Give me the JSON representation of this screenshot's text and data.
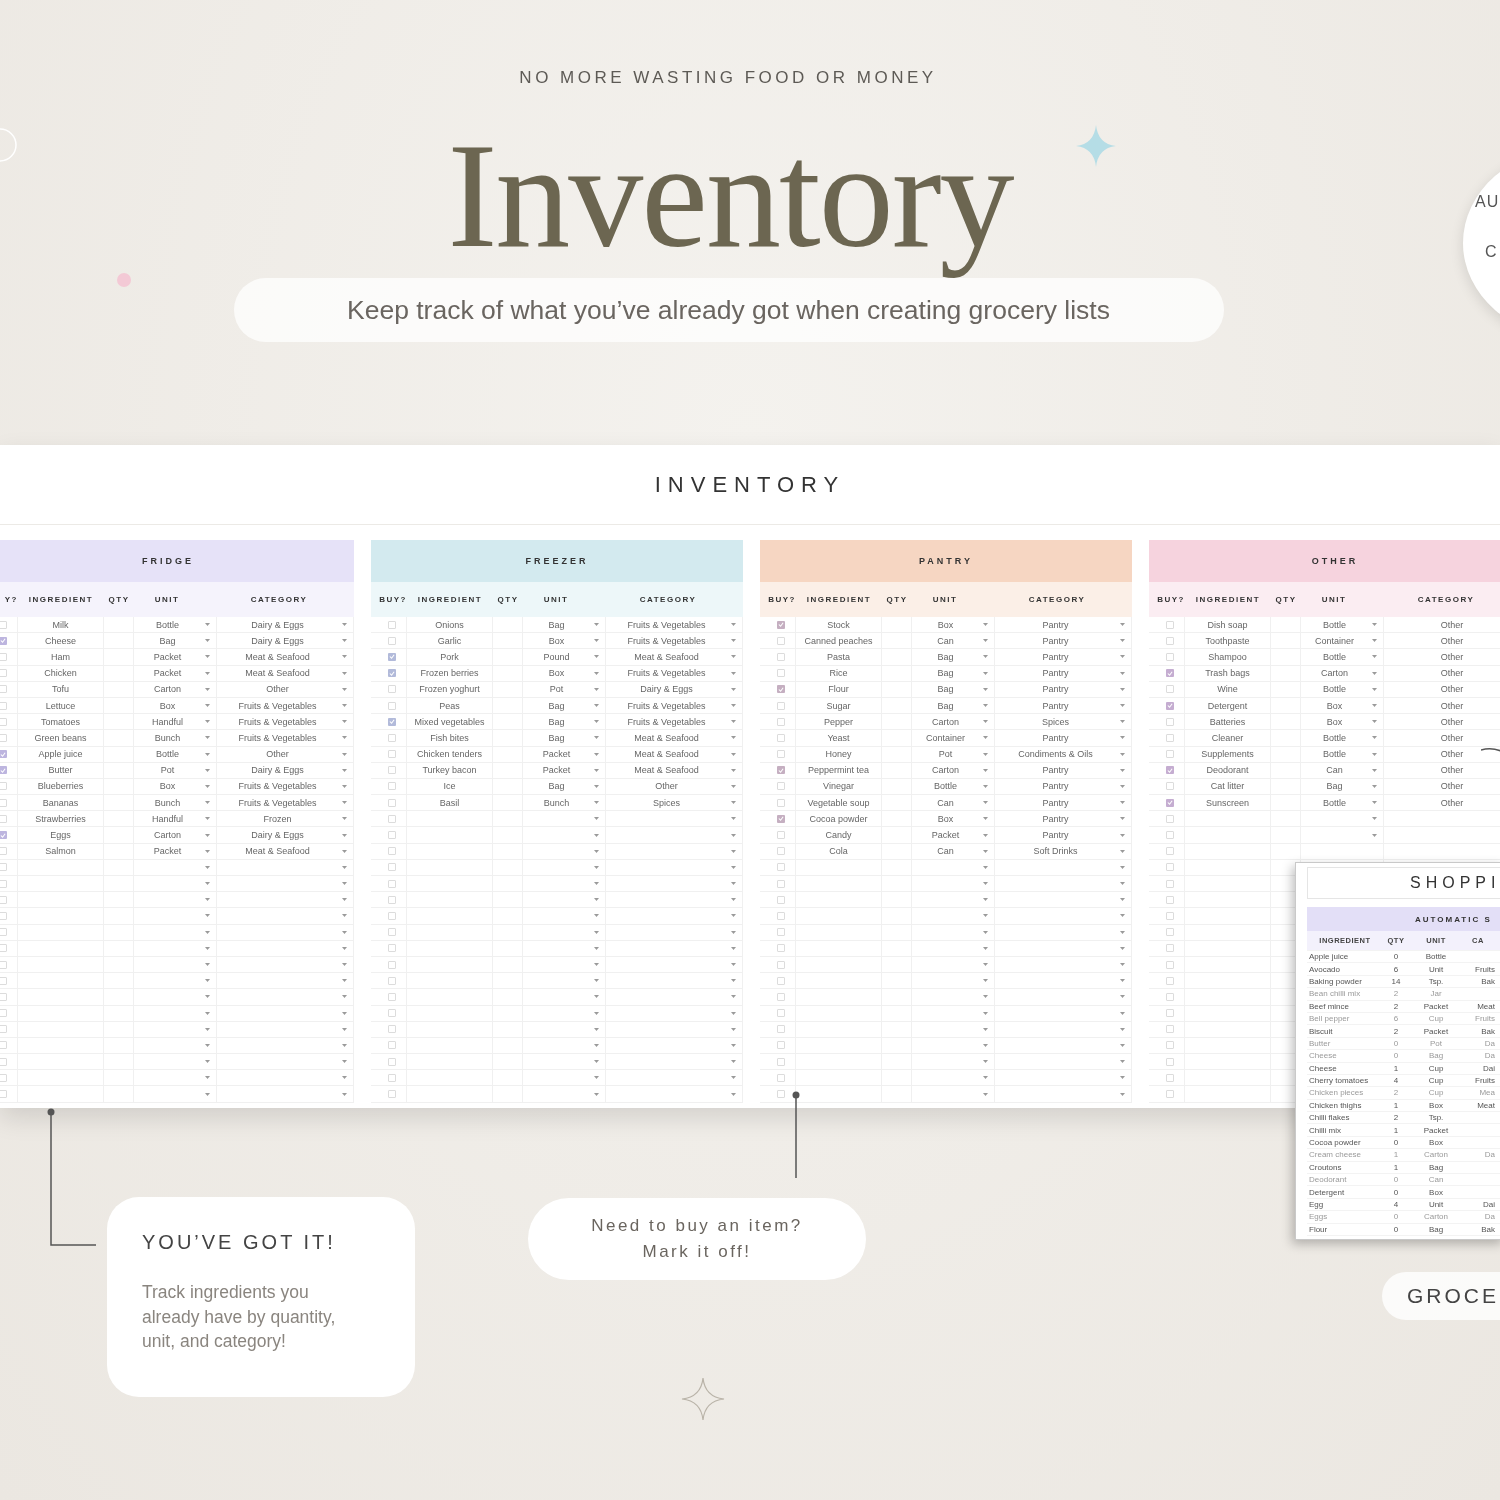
{
  "headline": {
    "kicker": "NO MORE WASTING FOOD OR MONEY",
    "title": "Inventory",
    "subtitle": "Keep track of what you’ve already got when creating grocery lists"
  },
  "badge": {
    "lines": [
      "AU",
      "C"
    ]
  },
  "sheet": {
    "title": "INVENTORY",
    "tables": [
      {
        "name": "FRIDGE",
        "color": "#e6e2f8",
        "category_dropdowns": true,
        "columns": [
          "Y?",
          "INGREDIENT",
          "QTY",
          "UNIT",
          "CATEGORY"
        ],
        "rows": [
          {
            "checked": false,
            "ingredient": "Milk",
            "unit": "Bottle",
            "category": "Dairy & Eggs"
          },
          {
            "checked": true,
            "ingredient": "Cheese",
            "unit": "Bag",
            "category": "Dairy & Eggs"
          },
          {
            "checked": false,
            "ingredient": "Ham",
            "unit": "Packet",
            "category": "Meat & Seafood"
          },
          {
            "checked": false,
            "ingredient": "Chicken",
            "unit": "Packet",
            "category": "Meat & Seafood"
          },
          {
            "checked": false,
            "ingredient": "Tofu",
            "unit": "Carton",
            "category": "Other"
          },
          {
            "checked": false,
            "ingredient": "Lettuce",
            "unit": "Box",
            "category": "Fruits & Vegetables"
          },
          {
            "checked": false,
            "ingredient": "Tomatoes",
            "unit": "Handful",
            "category": "Fruits & Vegetables"
          },
          {
            "checked": false,
            "ingredient": "Green beans",
            "unit": "Bunch",
            "category": "Fruits & Vegetables"
          },
          {
            "checked": true,
            "ingredient": "Apple juice",
            "unit": "Bottle",
            "category": "Other"
          },
          {
            "checked": true,
            "ingredient": "Butter",
            "unit": "Pot",
            "category": "Dairy & Eggs"
          },
          {
            "checked": false,
            "ingredient": "Blueberries",
            "unit": "Box",
            "category": "Fruits & Vegetables"
          },
          {
            "checked": false,
            "ingredient": "Bananas",
            "unit": "Bunch",
            "category": "Fruits & Vegetables"
          },
          {
            "checked": false,
            "ingredient": "Strawberries",
            "unit": "Handful",
            "category": "Frozen"
          },
          {
            "checked": true,
            "ingredient": "Eggs",
            "unit": "Carton",
            "category": "Dairy & Eggs"
          },
          {
            "checked": false,
            "ingredient": "Salmon",
            "unit": "Packet",
            "category": "Meat & Seafood"
          }
        ],
        "empty_rows": [
          {
            "checked": false,
            "dropdowns": true
          },
          {
            "checked": false,
            "dropdowns": true
          },
          {
            "checked": false,
            "dropdowns": true
          },
          {
            "checked": false,
            "dropdowns": true
          },
          {
            "checked": false,
            "dropdowns": true
          },
          {
            "checked": false,
            "dropdowns": true
          },
          {
            "checked": false,
            "dropdowns": true
          },
          {
            "checked": false,
            "dropdowns": true
          },
          {
            "checked": false,
            "dropdowns": true
          },
          {
            "checked": false,
            "dropdowns": true
          },
          {
            "checked": false,
            "dropdowns": true
          },
          {
            "checked": false,
            "dropdowns": true
          },
          {
            "checked": false,
            "dropdowns": true
          },
          {
            "checked": false,
            "dropdowns": true
          },
          {
            "checked": false,
            "dropdowns": true
          }
        ]
      },
      {
        "name": "FREEZER",
        "color": "#d3eaef",
        "category_dropdowns": true,
        "columns": [
          "BUY?",
          "INGREDIENT",
          "QTY",
          "UNIT",
          "CATEGORY"
        ],
        "rows": [
          {
            "checked": false,
            "ingredient": "Onions",
            "unit": "Bag",
            "category": "Fruits & Vegetables"
          },
          {
            "checked": false,
            "ingredient": "Garlic",
            "unit": "Box",
            "category": "Fruits & Vegetables"
          },
          {
            "checked": true,
            "ingredient": "Pork",
            "unit": "Pound",
            "category": "Meat & Seafood"
          },
          {
            "checked": true,
            "ingredient": "Frozen berries",
            "unit": "Box",
            "category": "Fruits & Vegetables"
          },
          {
            "checked": false,
            "ingredient": "Frozen yoghurt",
            "unit": "Pot",
            "category": "Dairy & Eggs"
          },
          {
            "checked": false,
            "ingredient": "Peas",
            "unit": "Bag",
            "category": "Fruits & Vegetables"
          },
          {
            "checked": true,
            "ingredient": "Mixed vegetables",
            "unit": "Bag",
            "category": "Fruits & Vegetables"
          },
          {
            "checked": false,
            "ingredient": "Fish bites",
            "unit": "Bag",
            "category": "Meat & Seafood"
          },
          {
            "checked": false,
            "ingredient": "Chicken tenders",
            "unit": "Packet",
            "category": "Meat & Seafood"
          },
          {
            "checked": false,
            "ingredient": "Turkey bacon",
            "unit": "Packet",
            "category": "Meat & Seafood"
          },
          {
            "checked": false,
            "ingredient": "Ice",
            "unit": "Bag",
            "category": "Other"
          },
          {
            "checked": false,
            "ingredient": "Basil",
            "unit": "Bunch",
            "category": "Spices"
          }
        ],
        "empty_rows": [
          {
            "checked": false,
            "dropdowns": true
          },
          {
            "checked": false,
            "dropdowns": true
          },
          {
            "checked": false,
            "dropdowns": true
          },
          {
            "checked": false,
            "dropdowns": true
          },
          {
            "checked": false,
            "dropdowns": true
          },
          {
            "checked": false,
            "dropdowns": true
          },
          {
            "checked": false,
            "dropdowns": true
          },
          {
            "checked": false,
            "dropdowns": true
          },
          {
            "checked": false,
            "dropdowns": true
          },
          {
            "checked": false,
            "dropdowns": true
          },
          {
            "checked": false,
            "dropdowns": true
          },
          {
            "checked": false,
            "dropdowns": true
          },
          {
            "checked": false,
            "dropdowns": true
          },
          {
            "checked": false,
            "dropdowns": true
          },
          {
            "checked": false,
            "dropdowns": true
          },
          {
            "checked": false,
            "dropdowns": true
          },
          {
            "checked": false,
            "dropdowns": true
          },
          {
            "checked": false,
            "dropdowns": true
          }
        ]
      },
      {
        "name": "PANTRY",
        "color": "#f6d6c2",
        "category_dropdowns": true,
        "columns": [
          "BUY?",
          "INGREDIENT",
          "QTY",
          "UNIT",
          "CATEGORY"
        ],
        "rows": [
          {
            "checked": true,
            "ingredient": "Stock",
            "unit": "Box",
            "category": "Pantry"
          },
          {
            "checked": false,
            "ingredient": "Canned peaches",
            "unit": "Can",
            "category": "Pantry"
          },
          {
            "checked": false,
            "ingredient": "Pasta",
            "unit": "Bag",
            "category": "Pantry"
          },
          {
            "checked": false,
            "ingredient": "Rice",
            "unit": "Bag",
            "category": "Pantry"
          },
          {
            "checked": true,
            "ingredient": "Flour",
            "unit": "Bag",
            "category": "Pantry"
          },
          {
            "checked": false,
            "ingredient": "Sugar",
            "unit": "Bag",
            "category": "Pantry"
          },
          {
            "checked": false,
            "ingredient": "Pepper",
            "unit": "Carton",
            "category": "Spices"
          },
          {
            "checked": false,
            "ingredient": "Yeast",
            "unit": "Container",
            "category": "Pantry"
          },
          {
            "checked": false,
            "ingredient": "Honey",
            "unit": "Pot",
            "category": "Condiments & Oils"
          },
          {
            "checked": true,
            "ingredient": "Peppermint tea",
            "unit": "Carton",
            "category": "Pantry"
          },
          {
            "checked": false,
            "ingredient": "Vinegar",
            "unit": "Bottle",
            "category": "Pantry"
          },
          {
            "checked": false,
            "ingredient": "Vegetable soup",
            "unit": "Can",
            "category": "Pantry"
          },
          {
            "checked": true,
            "ingredient": "Cocoa powder",
            "unit": "Box",
            "category": "Pantry"
          },
          {
            "checked": false,
            "ingredient": "Candy",
            "unit": "Packet",
            "category": "Pantry"
          },
          {
            "checked": false,
            "ingredient": "Cola",
            "unit": "Can",
            "category": "Soft Drinks"
          }
        ],
        "empty_rows": [
          {
            "checked": false,
            "dropdowns": true
          },
          {
            "checked": false,
            "dropdowns": true
          },
          {
            "checked": false,
            "dropdowns": true
          },
          {
            "checked": false,
            "dropdowns": true
          },
          {
            "checked": false,
            "dropdowns": true
          },
          {
            "checked": false,
            "dropdowns": true
          },
          {
            "checked": false,
            "dropdowns": true
          },
          {
            "checked": false,
            "dropdowns": true
          },
          {
            "checked": false,
            "dropdowns": true
          },
          {
            "checked": false,
            "dropdowns": true
          },
          {
            "checked": false,
            "dropdowns": true
          },
          {
            "checked": false,
            "dropdowns": true
          },
          {
            "checked": false,
            "dropdowns": true
          },
          {
            "checked": false,
            "dropdowns": true
          },
          {
            "checked": false,
            "dropdowns": true
          }
        ]
      },
      {
        "name": "OTHER",
        "color": "#f6d3de",
        "category_dropdowns": false,
        "columns": [
          "BUY?",
          "INGREDIENT",
          "QTY",
          "UNIT",
          "CATEGORY"
        ],
        "rows": [
          {
            "checked": false,
            "ingredient": "Dish soap",
            "unit": "Bottle",
            "category": "Other"
          },
          {
            "checked": false,
            "ingredient": "Toothpaste",
            "unit": "Container",
            "category": "Other"
          },
          {
            "checked": false,
            "ingredient": "Shampoo",
            "unit": "Bottle",
            "category": "Other"
          },
          {
            "checked": true,
            "ingredient": "Trash bags",
            "unit": "Carton",
            "category": "Other"
          },
          {
            "checked": false,
            "ingredient": "Wine",
            "unit": "Bottle",
            "category": "Other"
          },
          {
            "checked": true,
            "ingredient": "Detergent",
            "unit": "Box",
            "category": "Other"
          },
          {
            "checked": false,
            "ingredient": "Batteries",
            "unit": "Box",
            "category": "Other"
          },
          {
            "checked": false,
            "ingredient": "Cleaner",
            "unit": "Bottle",
            "category": "Other"
          },
          {
            "checked": false,
            "ingredient": "Supplements",
            "unit": "Bottle",
            "category": "Other"
          },
          {
            "checked": true,
            "ingredient": "Deodorant",
            "unit": "Can",
            "category": "Other"
          },
          {
            "checked": false,
            "ingredient": "Cat litter",
            "unit": "Bag",
            "category": "Other"
          },
          {
            "checked": true,
            "ingredient": "Sunscreen",
            "unit": "Bottle",
            "category": "Other"
          }
        ],
        "empty_rows": [
          {
            "checked": false,
            "dropdowns": true
          },
          {
            "checked": false,
            "dropdowns": true
          },
          {
            "checked": false,
            "dropdowns": false
          },
          {
            "checked": false,
            "dropdowns": false
          },
          {
            "checked": false,
            "dropdowns": false
          },
          {
            "checked": false,
            "dropdowns": false
          },
          {
            "checked": false,
            "dropdowns": false
          },
          {
            "checked": false,
            "dropdowns": false
          },
          {
            "checked": false,
            "dropdowns": false
          },
          {
            "checked": false,
            "dropdowns": false
          },
          {
            "checked": false,
            "dropdowns": false
          },
          {
            "checked": false,
            "dropdowns": false
          },
          {
            "checked": false,
            "dropdowns": false
          },
          {
            "checked": false,
            "dropdowns": false
          },
          {
            "checked": false,
            "dropdowns": false
          },
          {
            "checked": false,
            "dropdowns": false
          },
          {
            "checked": false,
            "dropdowns": false
          },
          {
            "checked": false,
            "dropdowns": false
          }
        ]
      }
    ]
  },
  "shopping_panel": {
    "title": "SHOPPI",
    "band": "AUTOMATIC S",
    "columns": [
      "INGREDIENT",
      "QTY",
      "UNIT",
      "CA"
    ],
    "rows": [
      {
        "ingredient": "Apple juice",
        "qty": "0",
        "unit": "Bottle",
        "dimmed": false
      },
      {
        "ingredient": "Avocado",
        "qty": "6",
        "unit": "Unit",
        "category": "Fruits",
        "dimmed": false
      },
      {
        "ingredient": "Baking powder",
        "qty": "14",
        "unit": "Tsp.",
        "category": "Bak",
        "dimmed": false
      },
      {
        "ingredient": "Bean chilli mix",
        "qty": "2",
        "unit": "Jar",
        "dimmed": true
      },
      {
        "ingredient": "Beef mince",
        "qty": "2",
        "unit": "Packet",
        "category": "Meat",
        "dimmed": false
      },
      {
        "ingredient": "Bell pepper",
        "qty": "6",
        "unit": "Cup",
        "category": "Fruits",
        "dimmed": true
      },
      {
        "ingredient": "Biscuit",
        "qty": "2",
        "unit": "Packet",
        "category": "Bak",
        "dimmed": false
      },
      {
        "ingredient": "Butter",
        "qty": "0",
        "unit": "Pot",
        "category": "Da",
        "dimmed": true
      },
      {
        "ingredient": "Cheese",
        "qty": "0",
        "unit": "Bag",
        "category": "Da",
        "dimmed": true
      },
      {
        "ingredient": "Cheese",
        "qty": "1",
        "unit": "Cup",
        "category": "Dai",
        "dimmed": false
      },
      {
        "ingredient": "Cherry tomatoes",
        "qty": "4",
        "unit": "Cup",
        "category": "Fruits",
        "dimmed": false
      },
      {
        "ingredient": "Chicken pieces",
        "qty": "2",
        "unit": "Cup",
        "category": "Mea",
        "dimmed": true
      },
      {
        "ingredient": "Chicken thighs",
        "qty": "1",
        "unit": "Box",
        "category": "Meat",
        "dimmed": false
      },
      {
        "ingredient": "Chilli flakes",
        "qty": "2",
        "unit": "Tsp.",
        "dimmed": false
      },
      {
        "ingredient": "Chilli mix",
        "qty": "1",
        "unit": "Packet",
        "dimmed": false
      },
      {
        "ingredient": "Cocoa powder",
        "qty": "0",
        "unit": "Box",
        "dimmed": false
      },
      {
        "ingredient": "Cream cheese",
        "qty": "1",
        "unit": "Carton",
        "category": "Da",
        "dimmed": true
      },
      {
        "ingredient": "Croutons",
        "qty": "1",
        "unit": "Bag",
        "dimmed": false
      },
      {
        "ingredient": "Deodorant",
        "qty": "0",
        "unit": "Can",
        "dimmed": true
      },
      {
        "ingredient": "Detergent",
        "qty": "0",
        "unit": "Box",
        "dimmed": false
      },
      {
        "ingredient": "Egg",
        "qty": "4",
        "unit": "Unit",
        "category": "Dai",
        "dimmed": false
      },
      {
        "ingredient": "Eggs",
        "qty": "0",
        "unit": "Carton",
        "category": "Da",
        "dimmed": true
      },
      {
        "ingredient": "Flour",
        "qty": "0",
        "unit": "Bag",
        "category": "Bak",
        "dimmed": false
      }
    ]
  },
  "callouts": [
    {
      "kind": "card",
      "title": "YOU’VE GOT IT!",
      "text": "Track ingredients you already have by quantity, unit, and category!"
    },
    {
      "kind": "pill",
      "text": "Need to buy an item?\nMark it off!"
    }
  ],
  "tag": {
    "text": "GROCE"
  }
}
